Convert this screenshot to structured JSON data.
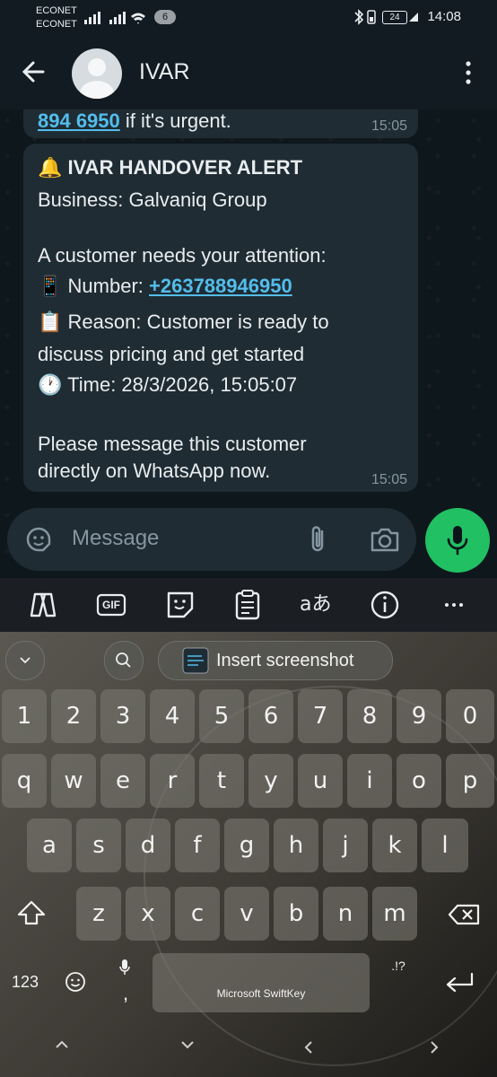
{
  "status_bar": {
    "carrier1": "ECONET",
    "carrier2": "ECONET",
    "notification_count": "6",
    "battery": "24",
    "time": "14:08"
  },
  "header": {
    "title": "IVAR"
  },
  "messages": [
    {
      "link_text": "894 6950",
      "text_after": " if it's urgent.",
      "time": "15:05"
    },
    {
      "emoji_bell": "🔔",
      "title": "IVAR HANDOVER ALERT",
      "business": "Business: Galvaniq Group",
      "intro": "A customer needs your attention:",
      "emoji_phone": "📱",
      "number_label": "Number: ",
      "number": "+263788946950",
      "emoji_clipboard": "📋",
      "reason_line1": "Reason: Customer is ready to",
      "reason_line2": "discuss pricing and get started",
      "emoji_clock": "🕐",
      "time_line": "Time: 28/3/2026, 15:05:07",
      "closing_line1": "Please message this customer",
      "closing_line2": "directly on WhatsApp now.",
      "time": "15:05"
    }
  ],
  "composer": {
    "placeholder": "Message"
  },
  "keyboard": {
    "toolbar_gif": "GIF",
    "suggestion": "Insert screenshot",
    "row_numbers": [
      "1",
      "2",
      "3",
      "4",
      "5",
      "6",
      "7",
      "8",
      "9",
      "0"
    ],
    "row1": [
      "q",
      "w",
      "e",
      "r",
      "t",
      "y",
      "u",
      "i",
      "o",
      "p"
    ],
    "row2": [
      "a",
      "s",
      "d",
      "f",
      "g",
      "h",
      "j",
      "k",
      "l"
    ],
    "row3": [
      "z",
      "x",
      "c",
      "v",
      "b",
      "n",
      "m"
    ],
    "symbols_key": "123",
    "comma": ",",
    "space_label": "Microsoft SwiftKey",
    "punct_key": ".!?"
  }
}
